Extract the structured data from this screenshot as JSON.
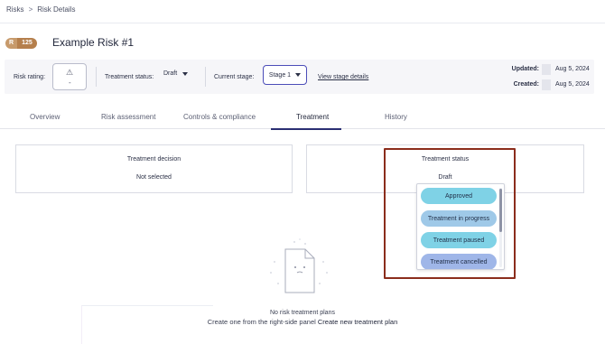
{
  "breadcrumb": {
    "root": "Risks",
    "separator": ">",
    "current": "Risk Details"
  },
  "risk": {
    "id_letter": "R",
    "id_number": "125",
    "title": "Example Risk #1"
  },
  "meta": {
    "rating_label": "Risk rating:",
    "rating_value": "-",
    "treatment_status_label": "Treatment status:",
    "treatment_status_value": "Draft",
    "current_stage_label": "Current stage:",
    "current_stage_value": "Stage 1",
    "view_stage_link": "View stage details",
    "updated_label": "Updated:",
    "updated_value": "Aug 5, 2024",
    "created_label": "Created:",
    "created_value": "Aug 5, 2024"
  },
  "tabs": [
    {
      "label": "Overview"
    },
    {
      "label": "Risk assessment"
    },
    {
      "label": "Controls & compliance"
    },
    {
      "label": "Treatment",
      "active": true
    },
    {
      "label": "History"
    }
  ],
  "treatment_decision": {
    "title": "Treatment decision",
    "value": "Not selected"
  },
  "treatment_status": {
    "title": "Treatment status",
    "value": "Draft",
    "options": [
      "Approved",
      "Treatment in progress",
      "Treatment paused",
      "Treatment cancelled"
    ]
  },
  "empty_state": {
    "title": "No risk treatment plans",
    "subtitle": "Create one from the right-side panel",
    "link": "Create new treatment plan"
  },
  "colors": {
    "accent": "#2b2f73",
    "stage_border": "#4c4db8",
    "highlight_border": "#8b2d1c",
    "option_cyan": "#7fd2e6",
    "option_blue": "#9fc9e8"
  }
}
